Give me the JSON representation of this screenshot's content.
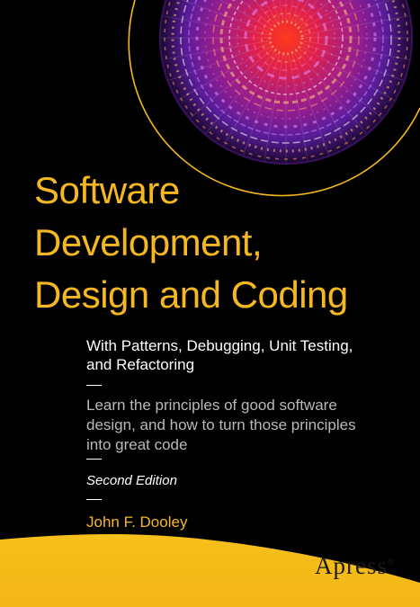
{
  "title": {
    "line1": "Software",
    "line2": "Development,",
    "line3": "Design and Coding"
  },
  "subtitle": {
    "line1": "With Patterns, Debugging, Unit Testing,",
    "line2": "and Refactoring"
  },
  "description": {
    "line1": "Learn the principles of good software",
    "line2": "design, and how to turn those principles",
    "line3": "into great code"
  },
  "edition": "Second Edition",
  "author": "John F. Dooley",
  "publisher": {
    "name": "Apress",
    "mark": "®"
  },
  "colors": {
    "background": "#000000",
    "title": "#f5b820",
    "accent_yellow": "#f7c21c",
    "subtitle": "#ffffff",
    "description": "#b9b9b9"
  }
}
